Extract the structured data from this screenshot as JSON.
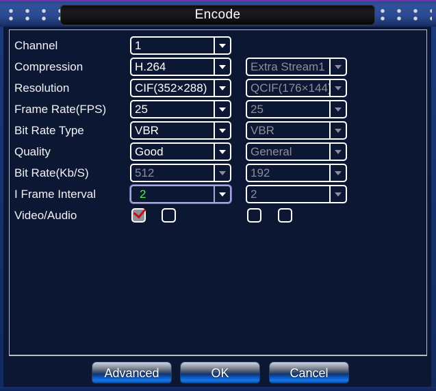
{
  "window": {
    "title": "Encode"
  },
  "form": {
    "rows": [
      {
        "label": "Channel",
        "main": {
          "value": "1",
          "disabled": false,
          "focused": false
        },
        "extra": null
      },
      {
        "label": "Compression",
        "main": {
          "value": "H.264",
          "disabled": false,
          "focused": false
        },
        "extra": {
          "value": "Extra Stream1",
          "disabled": true,
          "focused": false
        }
      },
      {
        "label": "Resolution",
        "main": {
          "value": "CIF(352×288)",
          "disabled": false,
          "focused": false
        },
        "extra": {
          "value": "QCIF(176×144)",
          "disabled": true,
          "focused": false
        }
      },
      {
        "label": "Frame Rate(FPS)",
        "main": {
          "value": "25",
          "disabled": false,
          "focused": false
        },
        "extra": {
          "value": "25",
          "disabled": true,
          "focused": false
        }
      },
      {
        "label": "Bit Rate Type",
        "main": {
          "value": "VBR",
          "disabled": false,
          "focused": false
        },
        "extra": {
          "value": "VBR",
          "disabled": true,
          "focused": false
        }
      },
      {
        "label": "Quality",
        "main": {
          "value": "Good",
          "disabled": false,
          "focused": false
        },
        "extra": {
          "value": "General",
          "disabled": true,
          "focused": false
        }
      },
      {
        "label": "Bit Rate(Kb/S)",
        "main": {
          "value": "512",
          "disabled": true,
          "focused": false
        },
        "extra": {
          "value": "192",
          "disabled": true,
          "focused": false
        }
      },
      {
        "label": "I Frame Interval",
        "main": {
          "value": "2",
          "disabled": false,
          "focused": true
        },
        "extra": {
          "value": "2",
          "disabled": true,
          "focused": false
        }
      }
    ],
    "video_audio": {
      "label": "Video/Audio",
      "checkboxes": [
        {
          "name": "main-video",
          "checked": true
        },
        {
          "name": "main-audio",
          "checked": false
        },
        {
          "name": "extra-video",
          "checked": false
        },
        {
          "name": "extra-audio",
          "checked": false
        }
      ]
    }
  },
  "buttons": {
    "advanced": "Advanced",
    "ok": "OK",
    "cancel": "Cancel"
  },
  "colors": {
    "background": "#0c1733",
    "titlebar": "#2c4b92",
    "focus_border": "#a9a7e0",
    "focus_text": "#4ef04e",
    "disabled_text": "#8b8f9c",
    "check_mark": "#cc0a17",
    "button_accent": "#1478e8"
  }
}
